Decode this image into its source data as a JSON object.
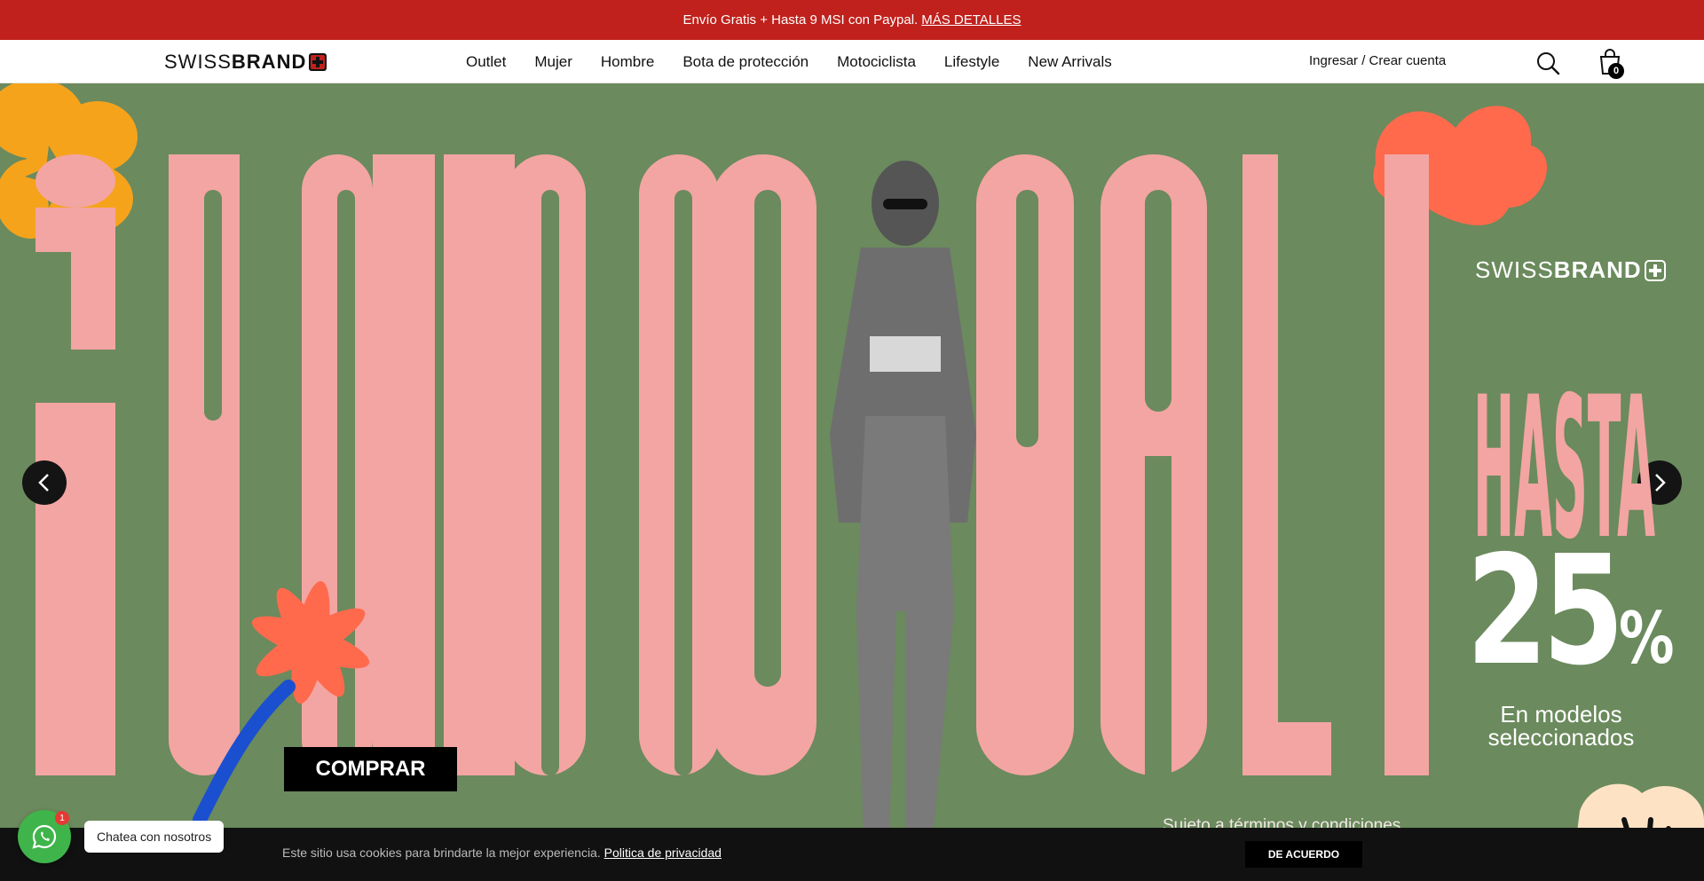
{
  "announcement": {
    "text": "Envío Gratis + Hasta 9 MSI con Paypal.",
    "link": "MÁS DETALLES",
    "bg_color": "#c0211c"
  },
  "header": {
    "logo_light": "SWISS",
    "logo_bold": "BRAND",
    "nav": [
      "Outlet",
      "Mujer",
      "Hombre",
      "Bota de protección",
      "Motociclista",
      "Lifestyle",
      "New Arrivals"
    ],
    "account_link": "Ingresar / Crear cuenta",
    "search_icon": "search-icon",
    "cart_icon": "cart-icon",
    "cart_count": "0"
  },
  "hero": {
    "bg_color": "#6b8a5d",
    "letter_color": "#f3a5a3",
    "brand_light": "SWISS",
    "brand_bold": "BRAND",
    "hasta": "HASTA",
    "percent": "25",
    "percent_sign": "%",
    "modelos_line1": "En modelos",
    "modelos_line2": "seleccionados",
    "cta": "COMPRAR",
    "terms": "Sujeto a términos y condiciones",
    "prev_icon": "chevron-left-icon",
    "next_icon": "chevron-right-icon"
  },
  "cookie": {
    "text": "Este sitio usa cookies para brindarte la mejor experiencia.",
    "link": "Politica de privacidad",
    "button": "DE ACUERDO"
  },
  "chat": {
    "badge": "1",
    "label": "Chatea con nosotros",
    "icon": "whatsapp-icon"
  }
}
